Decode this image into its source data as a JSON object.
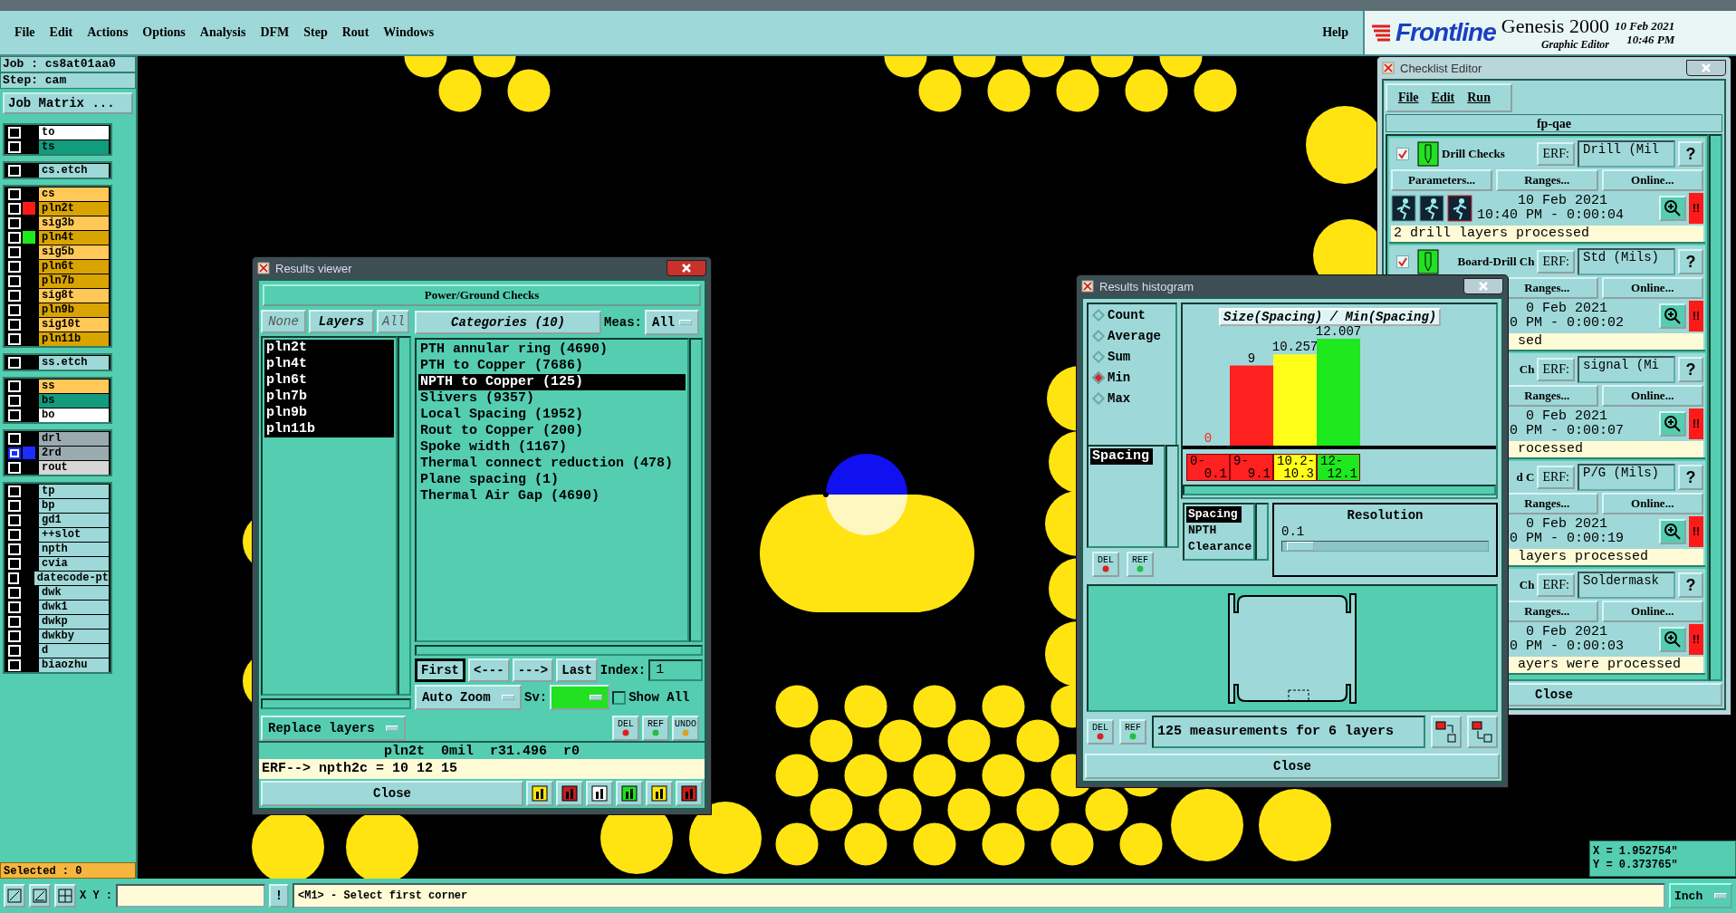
{
  "menu_bar": {
    "items": [
      "File",
      "Edit",
      "Actions",
      "Options",
      "Analysis",
      "DFM",
      "Step",
      "Rout",
      "Windows"
    ],
    "help": "Help"
  },
  "brand": {
    "company": "Frontline",
    "product": "Genesis 2000",
    "subtitle": "Graphic Editor",
    "date": "10 Feb 2021",
    "time": "10:46 PM"
  },
  "job_panel": {
    "job": "Job : cs8at01aa0",
    "step": "Step: cam",
    "matrix_button": "Job Matrix ...",
    "selected": "Selected : 0",
    "layer_groups": [
      {
        "layers": [
          {
            "name": "to",
            "color": "#ffffff",
            "active": false
          },
          {
            "name": "ts",
            "color": "#139b7e",
            "active": false
          }
        ]
      },
      {
        "layers": [
          {
            "name": "cs.etch",
            "color": "#9fd8d8",
            "active": false
          }
        ]
      },
      {
        "layers": [
          {
            "name": "cs",
            "color": "#ffc857",
            "active": false
          },
          {
            "name": "pln2t",
            "color": "#d9a400",
            "marker": {
              "color": "#ff1a1a"
            },
            "active": false
          },
          {
            "name": "sig3b",
            "color": "#ffc857",
            "active": false
          },
          {
            "name": "pln4t",
            "color": "#d9a400",
            "marker": {
              "color": "#1ee81e"
            },
            "active": false
          },
          {
            "name": "sig5b",
            "color": "#ffc857",
            "active": false
          },
          {
            "name": "pln6t",
            "color": "#d9a400",
            "active": false
          },
          {
            "name": "pln7b",
            "color": "#d9a400",
            "active": false
          },
          {
            "name": "sig8t",
            "color": "#ffc857",
            "active": false
          },
          {
            "name": "pln9b",
            "color": "#d9a400",
            "active": false
          },
          {
            "name": "sig10t",
            "color": "#ffc857",
            "active": false
          },
          {
            "name": "pln11b",
            "color": "#d9a400",
            "active": false
          }
        ]
      },
      {
        "layers": [
          {
            "name": "ss.etch",
            "color": "#9fd8d8",
            "active": false
          }
        ]
      },
      {
        "layers": [
          {
            "name": "ss",
            "color": "#ffc857",
            "active": false
          },
          {
            "name": "bs",
            "color": "#139b7e",
            "active": false
          },
          {
            "name": "bo",
            "color": "#ffffff",
            "active": false
          }
        ]
      },
      {
        "layers": [
          {
            "name": "drl",
            "color": "#9aabb0",
            "active": false
          },
          {
            "name": "2rd",
            "color": "#9aabb0",
            "marker": {
              "color": "#1a2cff"
            },
            "active": true
          },
          {
            "name": "rout",
            "color": "#d6d6d6",
            "active": false
          }
        ]
      },
      {
        "layers": [
          {
            "name": "tp",
            "color": "#9fd8d8",
            "active": false
          },
          {
            "name": "bp",
            "color": "#9fd8d8",
            "active": false
          },
          {
            "name": "gd1",
            "color": "#9fd8d8",
            "active": false
          },
          {
            "name": "++slot",
            "color": "#9fd8d8",
            "active": false
          },
          {
            "name": "npth",
            "color": "#9fd8d8",
            "active": false
          },
          {
            "name": "cvia",
            "color": "#9fd8d8",
            "active": false
          },
          {
            "name": "datecode-pt",
            "color": "#9fd8d8",
            "active": false
          },
          {
            "name": "dwk",
            "color": "#9fd8d8",
            "active": false
          },
          {
            "name": "dwk1",
            "color": "#9fd8d8",
            "active": false
          },
          {
            "name": "dwkp",
            "color": "#9fd8d8",
            "active": false
          },
          {
            "name": "dwkby",
            "color": "#9fd8d8",
            "active": false
          },
          {
            "name": "d",
            "color": "#9fd8d8",
            "active": false
          },
          {
            "name": "biaozhu",
            "color": "#9fd8d8",
            "active": false
          }
        ]
      }
    ]
  },
  "results_viewer": {
    "title": "Results viewer",
    "header": "Power/Ground Checks",
    "none_button": "None",
    "layers_label": "Layers",
    "all_button": "All",
    "categories_label": "Categories (10)",
    "meas_label": "Meas:",
    "meas_value": "All",
    "layers": [
      {
        "name": "pln2t",
        "selected": true
      },
      {
        "name": "pln4t",
        "selected": true
      },
      {
        "name": "pln6t",
        "selected": true
      },
      {
        "name": "pln7b",
        "selected": true
      },
      {
        "name": "pln9b",
        "selected": true
      },
      {
        "name": "pln11b",
        "selected": true
      }
    ],
    "categories": [
      {
        "label": "PTH annular ring (4690)",
        "selected": false
      },
      {
        "label": "PTH to Copper (7686)",
        "selected": false
      },
      {
        "label": "NPTH to Copper (125)",
        "selected": true
      },
      {
        "label": "Slivers (9357)",
        "selected": false
      },
      {
        "label": "Local Spacing (1952)",
        "selected": false
      },
      {
        "label": "Rout to Copper (200)",
        "selected": false
      },
      {
        "label": "Spoke width (1167)",
        "selected": false
      },
      {
        "label": "Thermal connect reduction (478)",
        "selected": false
      },
      {
        "label": "Plane spacing (1)",
        "selected": false
      },
      {
        "label": "Thermal Air Gap (4690)",
        "selected": false
      }
    ],
    "nav_buttons": [
      "First",
      "<---",
      "--->",
      "Last"
    ],
    "index_label": "Index:",
    "index_value": "1",
    "zoom_mode": "Auto Zoom",
    "sv_label": "Sv:",
    "show_all": {
      "label": "Show All",
      "checked": false
    },
    "replace_button": "Replace layers",
    "tools": [
      "DEL",
      "REF",
      "UNDO"
    ],
    "status": "pln2t  0mil  r31.496  r0",
    "erf_line": "ERF--> npth2c = 10 12 15",
    "close": "Close"
  },
  "checklist": {
    "title": "Checklist Editor",
    "menu": [
      "File",
      "Edit",
      "Run"
    ],
    "name": "fp-qae",
    "close": "Close",
    "checks": [
      {
        "kind": "full",
        "checked": true,
        "name": "Drill Checks",
        "erf_label": "ERF:",
        "erf": "Drill (Mil",
        "help": "?",
        "buttons": [
          "Parameters...",
          "Ranges...",
          "Online..."
        ],
        "date": "10 Feb 2021",
        "time": "10:40 PM - 0:00:04",
        "alert": "!!",
        "status": "2 drill layers processed"
      },
      {
        "kind": "partial",
        "checked": true,
        "name": "Board-Drill Ch",
        "erf_label": "ERF:",
        "erf": "Std (Mils)",
        "help": "?",
        "buttons": [
          "Ranges...",
          "Online..."
        ],
        "date": "0 Feb 2021",
        "time": "0 PM - 0:00:02",
        "alert": "!!",
        "status": "sed"
      },
      {
        "kind": "partial",
        "name": "Ch",
        "erf_label": "ERF:",
        "erf": "signal (Mi",
        "help": "?",
        "buttons": [
          "Ranges...",
          "Online..."
        ],
        "date": "0 Feb 2021",
        "time": "0 PM - 0:00:07",
        "alert": "!!",
        "status": "rocessed"
      },
      {
        "kind": "partial",
        "name": "d C",
        "erf_label": "ERF:",
        "erf": "P/G (Mils)",
        "help": "?",
        "buttons": [
          "Ranges...",
          "Online..."
        ],
        "date": "0 Feb 2021",
        "time": "0 PM - 0:00:19",
        "alert": "!!",
        "status": "layers processed"
      },
      {
        "kind": "partial",
        "name": "Ch",
        "erf_label": "ERF:",
        "erf": "Soldermask",
        "help": "?",
        "buttons": [
          "Ranges...",
          "Online..."
        ],
        "date": "0 Feb 2021",
        "time": "0 PM - 0:00:03",
        "alert": "!!",
        "status": "ayers were processed"
      }
    ]
  },
  "histogram": {
    "title": "Results histogram",
    "modes": [
      {
        "label": "Count",
        "selected": false
      },
      {
        "label": "Average",
        "selected": false
      },
      {
        "label": "Sum",
        "selected": false
      },
      {
        "label": "Min",
        "selected": true
      },
      {
        "label": "Max",
        "selected": false
      }
    ],
    "measures": [
      {
        "label": "Spacing",
        "selected": true
      }
    ],
    "measure_tools": [
      "DEL",
      "REF"
    ],
    "attributes": [
      {
        "label": "Spacing",
        "selected": true
      },
      {
        "label": "NPTH",
        "selected": false
      },
      {
        "label": "Clearance",
        "selected": false
      }
    ],
    "bins": [
      {
        "color": "#ff2020"
      },
      {
        "color": "#ff2020"
      },
      {
        "color": "#ffff1a"
      },
      {
        "color": "#1ee81e"
      }
    ],
    "chart_data": {
      "type": "bar",
      "title": "Size(Spacing) / Min(Spacing)",
      "categories": [
        "0-0.1",
        "9-9.1",
        "10.2-10.3",
        "12-12.1"
      ],
      "values": [
        0,
        9,
        10.257,
        12.007
      ],
      "value_labels": [
        "0",
        "9",
        "10.257",
        "12.007"
      ]
    },
    "resolution": {
      "label": "Resolution",
      "value": "0.1",
      "level": 0.02
    },
    "tools": [
      "DEL",
      "REF"
    ],
    "summary": "125 measurements for 6 layers",
    "close": "Close"
  },
  "coordinates": {
    "x": "X = 1.952754\"",
    "y": "Y = 0.373765\""
  },
  "bottom_bar": {
    "xy_label": "X Y :",
    "bang": "!",
    "message": "<M1> - Select first corner",
    "units": "Inch"
  }
}
